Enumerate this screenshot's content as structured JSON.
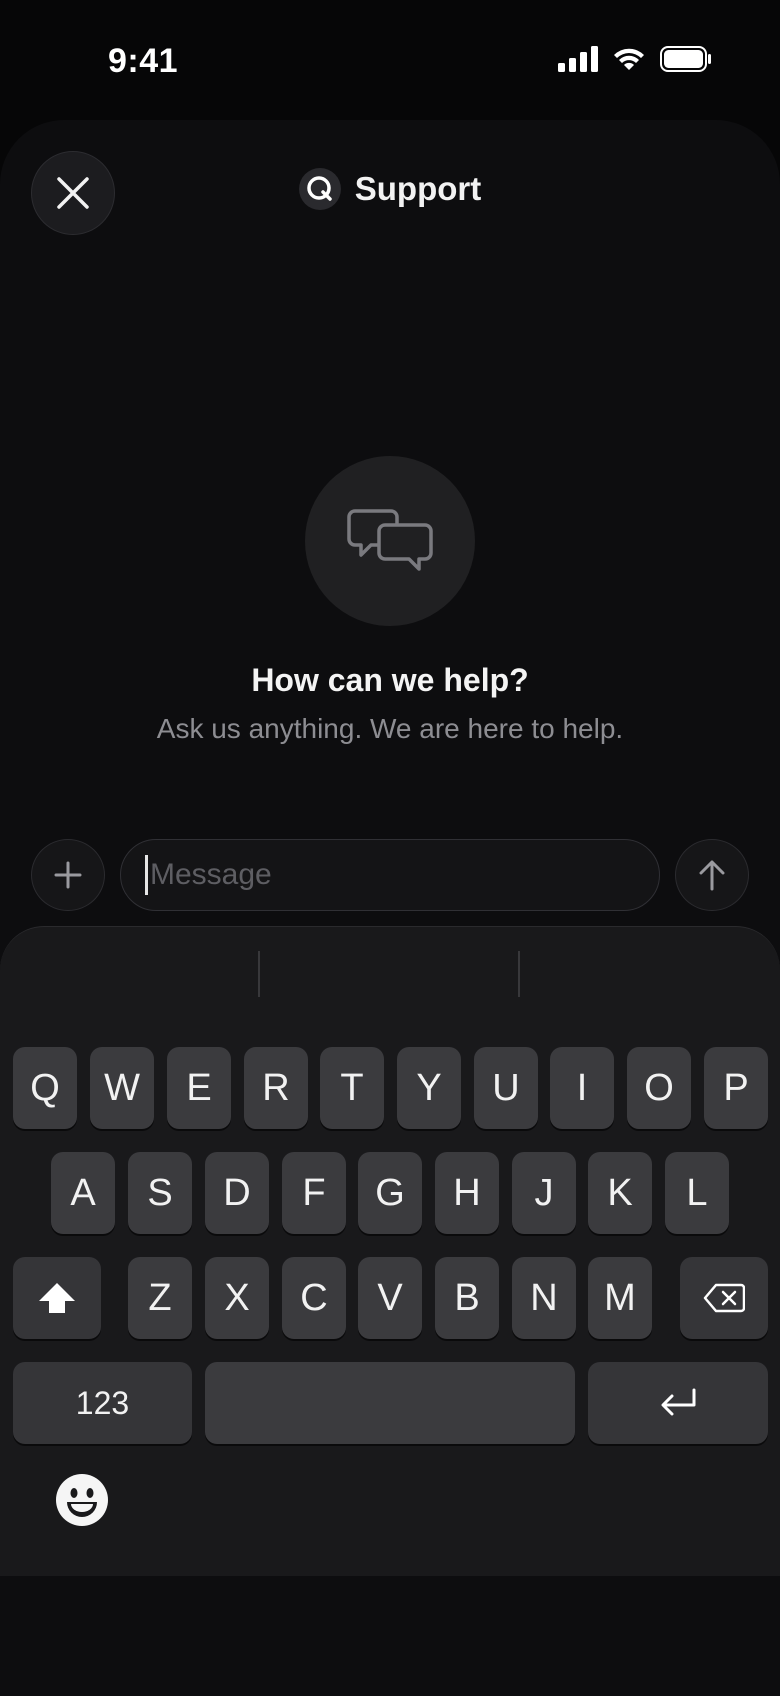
{
  "status_bar": {
    "time": "9:41"
  },
  "header": {
    "title": "Support",
    "close_icon": "close-icon",
    "logo_icon": "support-logo-icon"
  },
  "empty_state": {
    "icon": "chat-bubbles-icon",
    "title": "How can we help?",
    "subtitle": "Ask us anything. We are here to help."
  },
  "composer": {
    "placeholder": "Message",
    "attach_icon": "plus-icon",
    "send_icon": "arrow-up-icon"
  },
  "keyboard": {
    "row1": [
      "Q",
      "W",
      "E",
      "R",
      "T",
      "Y",
      "U",
      "I",
      "O",
      "P"
    ],
    "row2": [
      "A",
      "S",
      "D",
      "F",
      "G",
      "H",
      "J",
      "K",
      "L"
    ],
    "row3": [
      "Z",
      "X",
      "C",
      "V",
      "B",
      "N",
      "M"
    ],
    "numbers_label": "123",
    "space_label": "",
    "shift_icon": "shift-icon",
    "backspace_icon": "backspace-icon",
    "return_icon": "return-icon",
    "emoji_icon": "emoji-icon"
  },
  "colors": {
    "background": "#060607",
    "sheet": "#0d0d0f",
    "key": "#3b3b3e",
    "keyboard": "#19191b",
    "muted_text": "#8d8d92"
  }
}
